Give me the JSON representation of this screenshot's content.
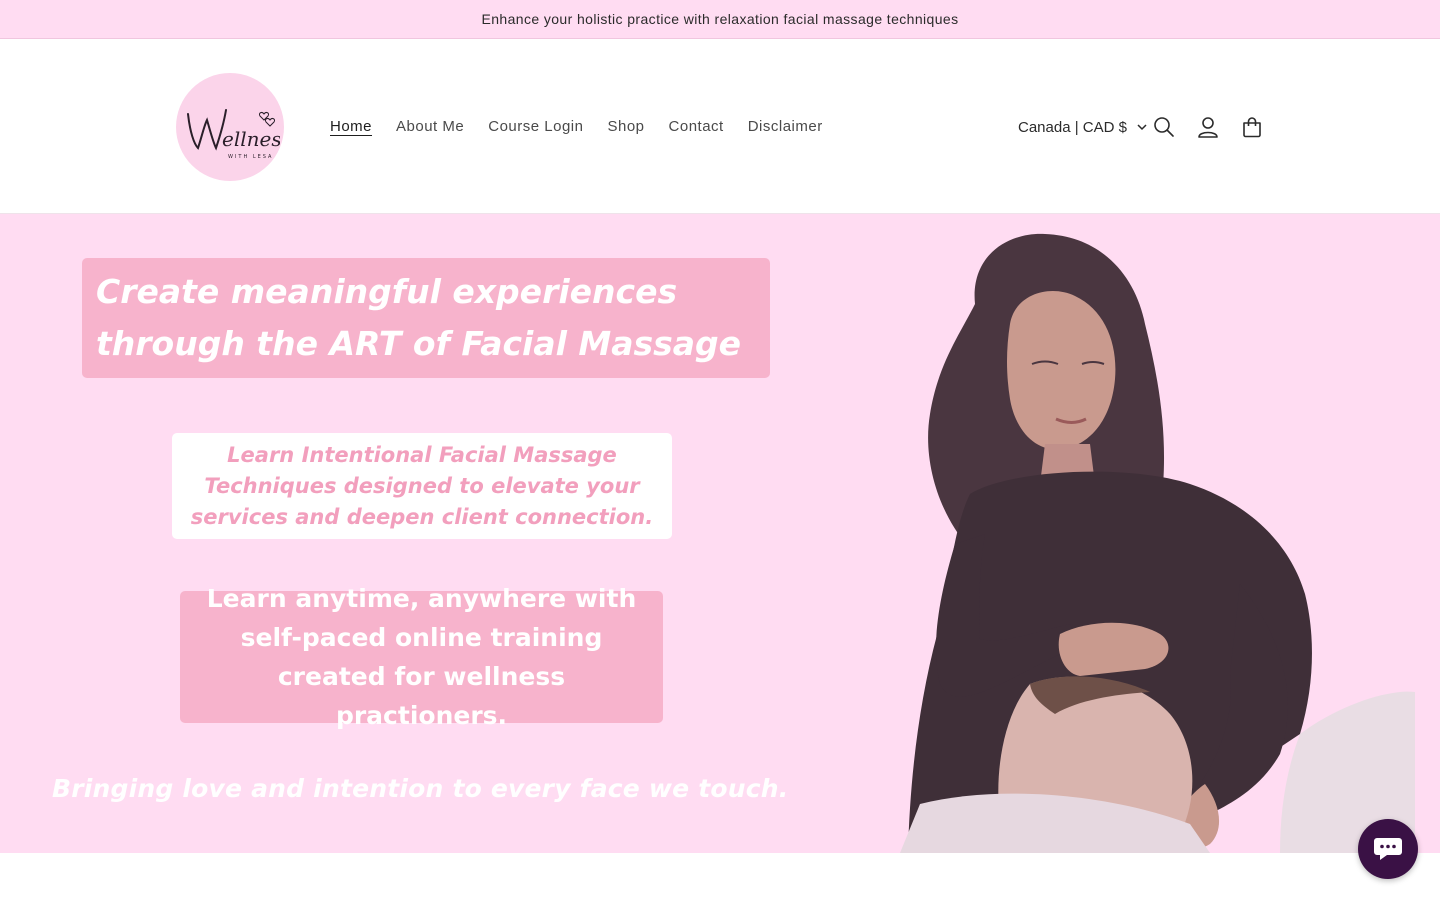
{
  "announcement": "Enhance your holistic practice with relaxation facial massage techniques",
  "logo": {
    "wordmark": "Wellness",
    "subtext": "WITH LESA"
  },
  "nav": [
    {
      "label": "Home",
      "active": true
    },
    {
      "label": "About Me"
    },
    {
      "label": "Course Login"
    },
    {
      "label": "Shop"
    },
    {
      "label": "Contact"
    },
    {
      "label": "Disclaimer"
    }
  ],
  "country_selector": "Canada | CAD $",
  "icons": {
    "search": "search-icon",
    "account": "account-icon",
    "cart": "cart-icon",
    "chat": "chat-icon",
    "dropdown": "chevron-down-icon"
  },
  "hero": {
    "headline_line1": "Create  meaningful experiences",
    "headline_line2": "through the ART of Facial Massage",
    "subtitle_lines": [
      "Learn Intentional Facial Massage",
      "Techniques designed to elevate your",
      "services and deepen client connection."
    ],
    "info_lines": [
      "Learn anytime, anywhere with",
      "self-paced online training",
      "created for wellness practioners."
    ],
    "tagline": "Bringing love and intention to every face we touch."
  },
  "colors": {
    "pink_bg": "#ffdcf2",
    "pink_box": "#f7b3cc",
    "pink_text": "#f29fbd",
    "chat": "#3a1145"
  }
}
